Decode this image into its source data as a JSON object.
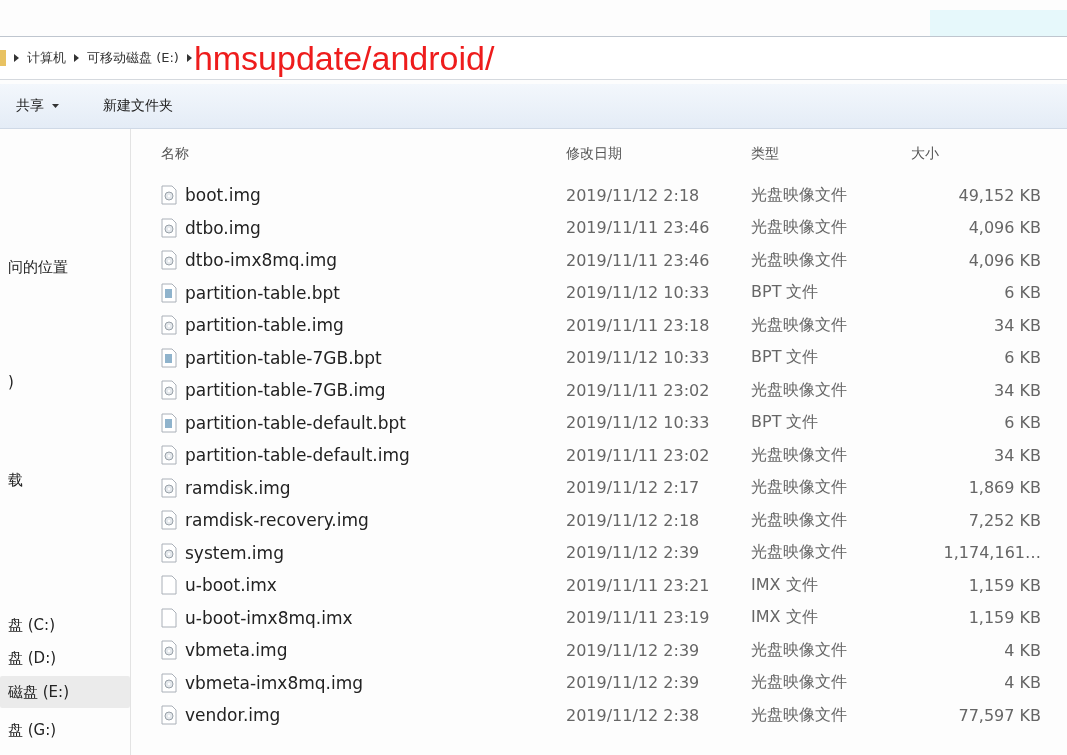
{
  "address_bar": {
    "crumbs": [
      "计算机",
      "可移动磁盘 (E:)"
    ],
    "annotation": "hmsupdate/android/"
  },
  "toolbar": {
    "buttons": [
      {
        "label": "共享",
        "dropdown": true
      },
      {
        "label": "新建文件夹",
        "dropdown": false
      }
    ]
  },
  "sidebar": {
    "items": [
      {
        "label": "问的位置",
        "selected": false
      },
      {
        "label": ")",
        "selected": false
      },
      {
        "label": "载",
        "selected": false
      },
      {
        "label": "盘 (C:)",
        "selected": false
      },
      {
        "label": "盘 (D:)",
        "selected": false
      },
      {
        "label": "磁盘 (E:)",
        "selected": true
      },
      {
        "label": "盘 (G:)",
        "selected": false
      }
    ]
  },
  "table": {
    "columns": [
      "名称",
      "修改日期",
      "类型",
      "大小"
    ],
    "rows": [
      {
        "kind": "disc",
        "name": "boot.img",
        "date": "2019/11/12 2:18",
        "type": "光盘映像文件",
        "size": "49,152 KB"
      },
      {
        "kind": "disc",
        "name": "dtbo.img",
        "date": "2019/11/11 23:46",
        "type": "光盘映像文件",
        "size": "4,096 KB"
      },
      {
        "kind": "disc",
        "name": "dtbo-imx8mq.img",
        "date": "2019/11/11 23:46",
        "type": "光盘映像文件",
        "size": "4,096 KB"
      },
      {
        "kind": "doc",
        "name": "partition-table.bpt",
        "date": "2019/11/12 10:33",
        "type": "BPT 文件",
        "size": "6 KB"
      },
      {
        "kind": "disc",
        "name": "partition-table.img",
        "date": "2019/11/11 23:18",
        "type": "光盘映像文件",
        "size": "34 KB"
      },
      {
        "kind": "doc",
        "name": "partition-table-7GB.bpt",
        "date": "2019/11/12 10:33",
        "type": "BPT 文件",
        "size": "6 KB"
      },
      {
        "kind": "disc",
        "name": "partition-table-7GB.img",
        "date": "2019/11/11 23:02",
        "type": "光盘映像文件",
        "size": "34 KB"
      },
      {
        "kind": "doc",
        "name": "partition-table-default.bpt",
        "date": "2019/11/12 10:33",
        "type": "BPT 文件",
        "size": "6 KB"
      },
      {
        "kind": "disc",
        "name": "partition-table-default.img",
        "date": "2019/11/11 23:02",
        "type": "光盘映像文件",
        "size": "34 KB"
      },
      {
        "kind": "disc",
        "name": "ramdisk.img",
        "date": "2019/11/12 2:17",
        "type": "光盘映像文件",
        "size": "1,869 KB"
      },
      {
        "kind": "disc",
        "name": "ramdisk-recovery.img",
        "date": "2019/11/12 2:18",
        "type": "光盘映像文件",
        "size": "7,252 KB"
      },
      {
        "kind": "disc",
        "name": "system.img",
        "date": "2019/11/12 2:39",
        "type": "光盘映像文件",
        "size": "1,174,161…"
      },
      {
        "kind": "blank",
        "name": "u-boot.imx",
        "date": "2019/11/11 23:21",
        "type": "IMX 文件",
        "size": "1,159 KB"
      },
      {
        "kind": "blank",
        "name": "u-boot-imx8mq.imx",
        "date": "2019/11/11 23:19",
        "type": "IMX 文件",
        "size": "1,159 KB"
      },
      {
        "kind": "disc",
        "name": "vbmeta.img",
        "date": "2019/11/12 2:39",
        "type": "光盘映像文件",
        "size": "4 KB"
      },
      {
        "kind": "disc",
        "name": "vbmeta-imx8mq.img",
        "date": "2019/11/12 2:39",
        "type": "光盘映像文件",
        "size": "4 KB"
      },
      {
        "kind": "disc",
        "name": "vendor.img",
        "date": "2019/11/12 2:38",
        "type": "光盘映像文件",
        "size": "77,597 KB"
      }
    ]
  }
}
